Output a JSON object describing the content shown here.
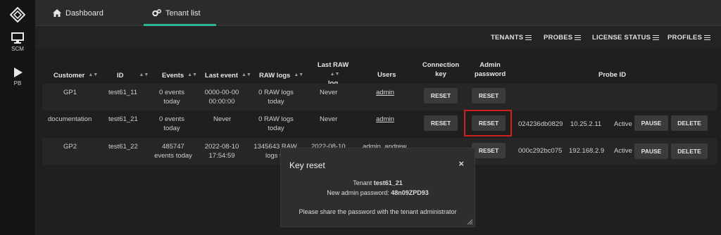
{
  "rail": {
    "items": [
      {
        "label": "SCM"
      },
      {
        "label": "PB"
      }
    ]
  },
  "nav": {
    "tabs": [
      {
        "label": "Dashboard"
      },
      {
        "label": "Tenant list"
      }
    ],
    "menus": [
      "TENANTS",
      "PROBES",
      "LICENSE STATUS",
      "PROFILES"
    ]
  },
  "table": {
    "headers": {
      "customer": "Customer",
      "id": "ID",
      "events": "Events",
      "last_event": "Last event",
      "raw_logs": "RAW logs",
      "last_raw_1": "Last RAW",
      "last_raw_2": "log",
      "users": "Users",
      "conn_1": "Connection",
      "conn_2": "key",
      "admin_1": "Admin",
      "admin_2": "password",
      "probe_id": "Probe ID"
    },
    "rows": [
      {
        "customer": "GP1",
        "id": "test61_11",
        "events_1": "0 events",
        "events_2": "today",
        "last_event_1": "0000-00-00",
        "last_event_2": "00:00:00",
        "raw_1": "0 RAW logs",
        "raw_2": "today",
        "last_raw": "Never",
        "users": "admin",
        "conn_btn": "RESET",
        "admin_btn": "RESET"
      },
      {
        "customer": "documentation",
        "id": "test61_21",
        "events_1": "0 events",
        "events_2": "today",
        "last_event_1": "Never",
        "raw_1": "0 RAW logs",
        "raw_2": "today",
        "last_raw": "Never",
        "users": "admin",
        "conn_btn": "RESET",
        "admin_btn": "RESET",
        "probe": "024236db0829",
        "ip": "10.25.2.11",
        "status": "Active",
        "pause_btn": "PAUSE",
        "delete_btn": "DELETE"
      },
      {
        "customer": "GP2",
        "id": "test61_22",
        "events_1": "485747",
        "events_2": "events today",
        "last_event_1": "2022-08-10",
        "last_event_2": "17:54:59",
        "raw_1": "1345643 RAW",
        "raw_2": "logs to",
        "last_raw": "2022-08-10",
        "users": "admin, andrew",
        "admin_btn": "RESET",
        "probe": "000c292bc075",
        "ip": "192.168.2.9",
        "status": "Active",
        "pause_btn": "PAUSE",
        "delete_btn": "DELETE"
      }
    ]
  },
  "modal": {
    "title": "Key reset",
    "close": "×",
    "tenant_label": "Tenant",
    "tenant_value": "test61_21",
    "password_label": "New admin password:",
    "password_value": "48n09ZPD93",
    "note": "Please share the password with the tenant administrator"
  },
  "colors": {
    "accent": "#2fb59a",
    "highlight": "#d11e1e"
  }
}
